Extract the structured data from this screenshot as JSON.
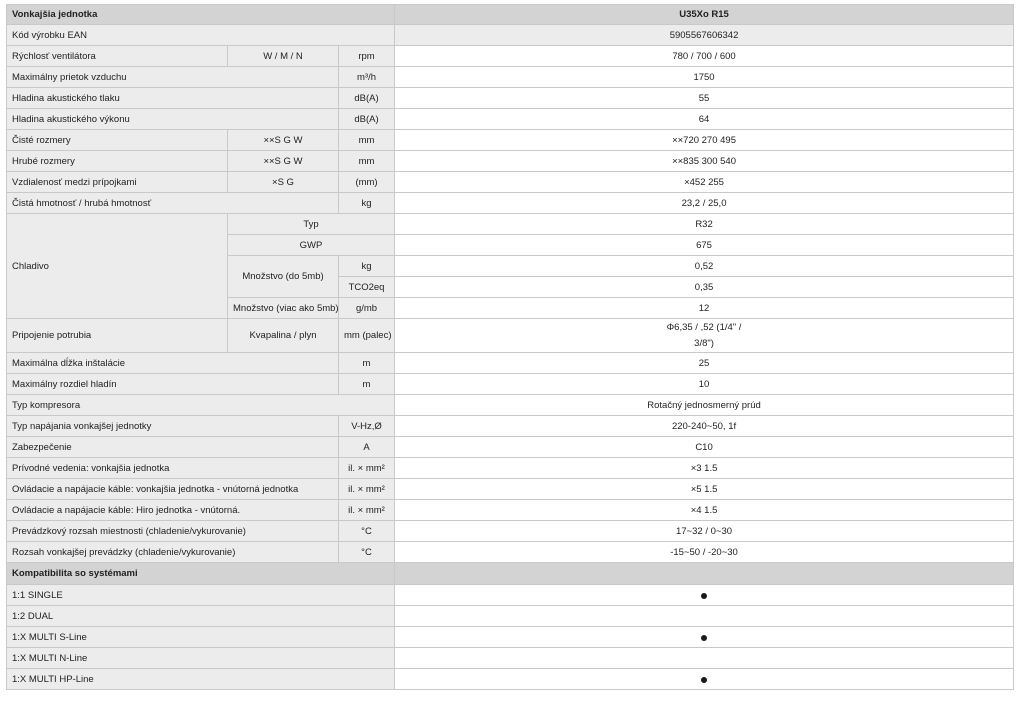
{
  "table": {
    "header": {
      "title": "Vonkajšia jednotka",
      "model": "U35Xo R15"
    },
    "ean": {
      "label": "Kód výrobku EAN",
      "value": "5905567606342"
    },
    "fan": {
      "label": "Rýchlosť ventilátora",
      "param": "W / M / N",
      "unit": "rpm",
      "value": "780 / 700 / 600"
    },
    "airflow": {
      "label": "Maximálny prietok vzduchu",
      "unit": "m³/h",
      "value": "1750"
    },
    "pressure": {
      "label": "Hladina akustického tlaku",
      "unit": "dB(A)",
      "value": "55"
    },
    "power": {
      "label": "Hladina akustického výkonu",
      "unit": "dB(A)",
      "value": "64"
    },
    "net_dim": {
      "label": "Čisté rozmery",
      "param": "××S G W",
      "unit": "mm",
      "value": "××720 270 495"
    },
    "gross_dim": {
      "label": "Hrubé rozmery",
      "param": "××S G W",
      "unit": "mm",
      "value": "××835 300 540"
    },
    "conn_dist": {
      "label": "Vzdialenosť medzi prípojkami",
      "param": "×S G",
      "unit": "(mm)",
      "value": "×452 255"
    },
    "weight": {
      "label": "Čistá hmotnosť / hrubá hmotnosť",
      "unit": "kg",
      "value": "23,2 / 25,0"
    },
    "refrigerant": {
      "label": "Chladivo",
      "type_label": "Typ",
      "type_value": "R32",
      "gwp_label": "GWP",
      "gwp_value": "675",
      "qty_label": "Množstvo (do 5mb)",
      "qty_unit1": "kg",
      "qty_value1": "0,52",
      "qty_unit2": "TCO2eq",
      "qty_value2": "0,35",
      "extra_label": "Množstvo (viac ako 5mb)",
      "extra_unit": "g/mb",
      "extra_value": "12"
    },
    "piping": {
      "label": "Pripojenie potrubia",
      "param": "Kvapalina / plyn",
      "unit": "mm (palec)",
      "value_line1": "Φ6,35 / ,52 (1/4\" /",
      "value_line2": "3/8\")"
    },
    "max_len": {
      "label": "Maximálna dĺžka inštalácie",
      "unit": "m",
      "value": "25"
    },
    "max_height": {
      "label": "Maximálny rozdiel hladín",
      "unit": "m",
      "value": "10"
    },
    "compressor": {
      "label": "Typ kompresora",
      "value": "Rotačný jednosmerný prúd"
    },
    "supply": {
      "label": "Typ napájania vonkajšej jednotky",
      "unit": "V-Hz,Ø",
      "value": "220-240~50, 1f"
    },
    "fuse": {
      "label": "Zabezpečenie",
      "unit": "A",
      "value": "C10"
    },
    "supply_lines": {
      "label": "Prívodné vedenia: vonkajšia jednotka",
      "unit": "il. × mm²",
      "value": "×3 1.5"
    },
    "cables1": {
      "label": "Ovládacie a napájacie káble: vonkajšia jednotka - vnútorná jednotka",
      "unit": "il. × mm²",
      "value": "×5 1.5"
    },
    "cables2": {
      "label": "Ovládacie a napájacie káble: Hiro jednotka - vnútorná.",
      "unit": "il. × mm²",
      "value": "×4 1.5"
    },
    "room_range": {
      "label": "Prevádzkový rozsah miestnosti (chladenie/vykurovanie)",
      "unit": "°C",
      "value": "17~32 / 0~30"
    },
    "outdoor_range": {
      "label": "Rozsah vonkajšej prevádzky (chladenie/vykurovanie)",
      "unit": "°C",
      "value": "-15~50 / -20~30"
    },
    "compat": {
      "title": "Kompatibilita so systémami",
      "rows": [
        {
          "label": "1:1 SINGLE",
          "supported": true
        },
        {
          "label": "1:2 DUAL",
          "supported": false
        },
        {
          "label": "1:X MULTI S-Line",
          "supported": true
        },
        {
          "label": "1:X MULTI N-Line",
          "supported": false
        },
        {
          "label": "1:X MULTI HP-Line",
          "supported": true
        }
      ]
    }
  }
}
